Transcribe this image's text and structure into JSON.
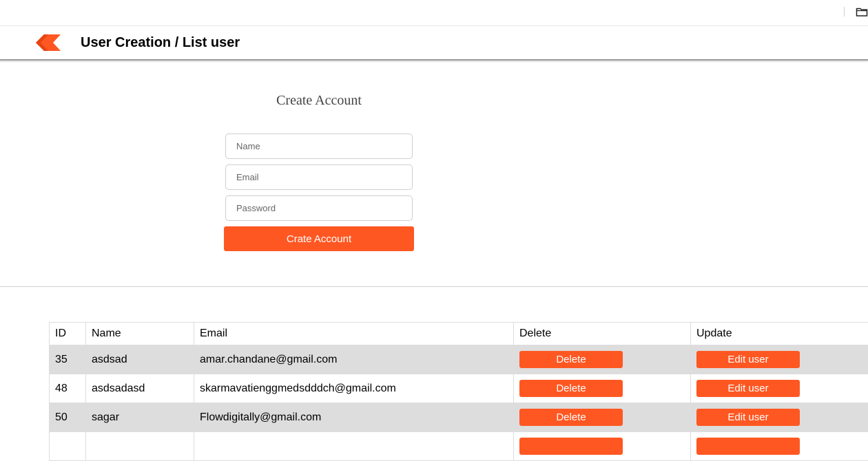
{
  "header": {
    "title": "User Creation / List user"
  },
  "form": {
    "title": "Create Account",
    "name_placeholder": "Name",
    "email_placeholder": "Email",
    "password_placeholder": "Password",
    "submit_label": "Crate Account"
  },
  "table": {
    "columns": [
      "ID",
      "Name",
      "Email",
      "Delete",
      "Update"
    ],
    "rows": [
      {
        "id": "35",
        "name": "asdsad",
        "email": "amar.chandane@gmail.com",
        "delete_label": "Delete",
        "update_label": "Edit user"
      },
      {
        "id": "48",
        "name": "asdsadasd",
        "email": "skarmavatienggmedsdddch@gmail.com",
        "delete_label": "Delete",
        "update_label": "Edit user"
      },
      {
        "id": "50",
        "name": "sagar",
        "email": "Flowdigitally@gmail.com",
        "delete_label": "Delete",
        "update_label": "Edit user"
      },
      {
        "id": "",
        "name": "",
        "email": "",
        "delete_label": "",
        "update_label": ""
      }
    ]
  },
  "colors": {
    "accent": "#ff5722",
    "row_alt": "#dddddd"
  },
  "icons": {
    "logo": "chevron-logo-icon",
    "folder": "folder-icon"
  }
}
